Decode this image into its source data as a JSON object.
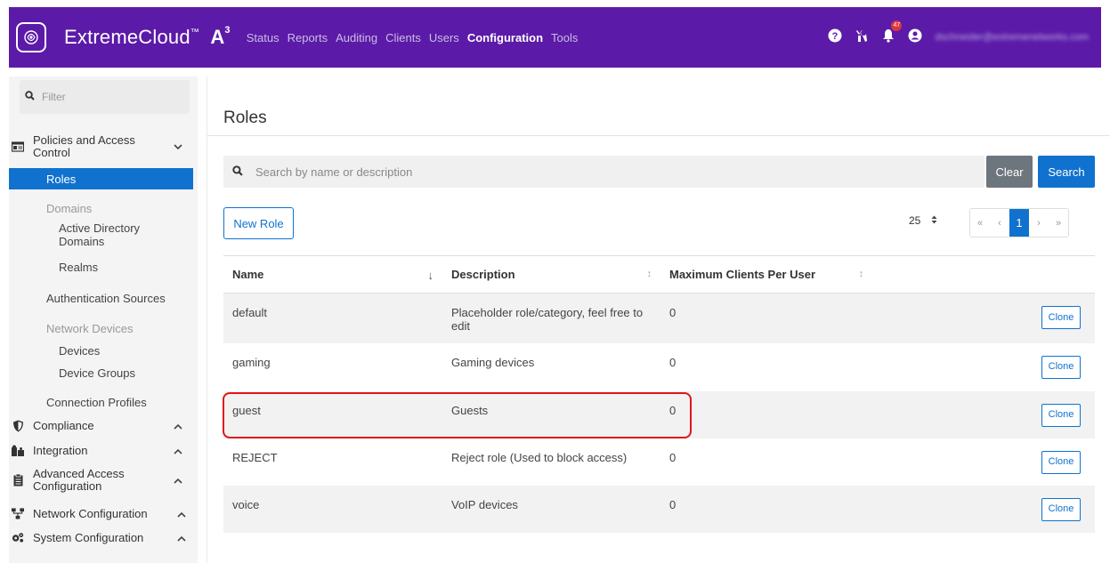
{
  "header": {
    "brand": "ExtremeCloud",
    "brand_tm": "™",
    "product": "A",
    "product_sup": "3",
    "nav": [
      "Status",
      "Reports",
      "Auditing",
      "Clients",
      "Users",
      "Configuration",
      "Tools"
    ],
    "active_nav": "Configuration",
    "notification_count": "47",
    "user_email": "dschneider@extremenetworks.com",
    "accent_color": "#5c1aa8"
  },
  "sidebar": {
    "filter_placeholder": "Filter",
    "policies_label": "Policies and Access Control",
    "roles_label": "Roles",
    "domains_label": "Domains",
    "active_directory_label": "Active Directory Domains",
    "realms_label": "Realms",
    "auth_sources_label": "Authentication Sources",
    "network_devices_label": "Network Devices",
    "devices_label": "Devices",
    "device_groups_label": "Device Groups",
    "connection_profiles_label": "Connection Profiles",
    "compliance_label": "Compliance",
    "integration_label": "Integration",
    "advanced_access_label": "Advanced Access Configuration",
    "network_config_label": "Network Configuration",
    "system_config_label": "System Configuration"
  },
  "main": {
    "title": "Roles",
    "search_placeholder": "Search by name or description",
    "clear_label": "Clear",
    "search_label": "Search",
    "new_role_label": "New Role",
    "per_page": "25",
    "current_page": "1",
    "columns": {
      "name": "Name",
      "description": "Description",
      "max_clients": "Maximum Clients Per User"
    },
    "clone_label": "Clone",
    "rows": [
      {
        "name": "default",
        "description": "Placeholder role/category, feel free to edit",
        "max_clients": "0"
      },
      {
        "name": "gaming",
        "description": "Gaming devices",
        "max_clients": "0"
      },
      {
        "name": "guest",
        "description": "Guests",
        "max_clients": "0"
      },
      {
        "name": "REJECT",
        "description": "Reject role (Used to block access)",
        "max_clients": "0"
      },
      {
        "name": "voice",
        "description": "VoIP devices",
        "max_clients": "0"
      }
    ],
    "highlighted_row": "guest",
    "highlight_color": "#e0151c"
  }
}
